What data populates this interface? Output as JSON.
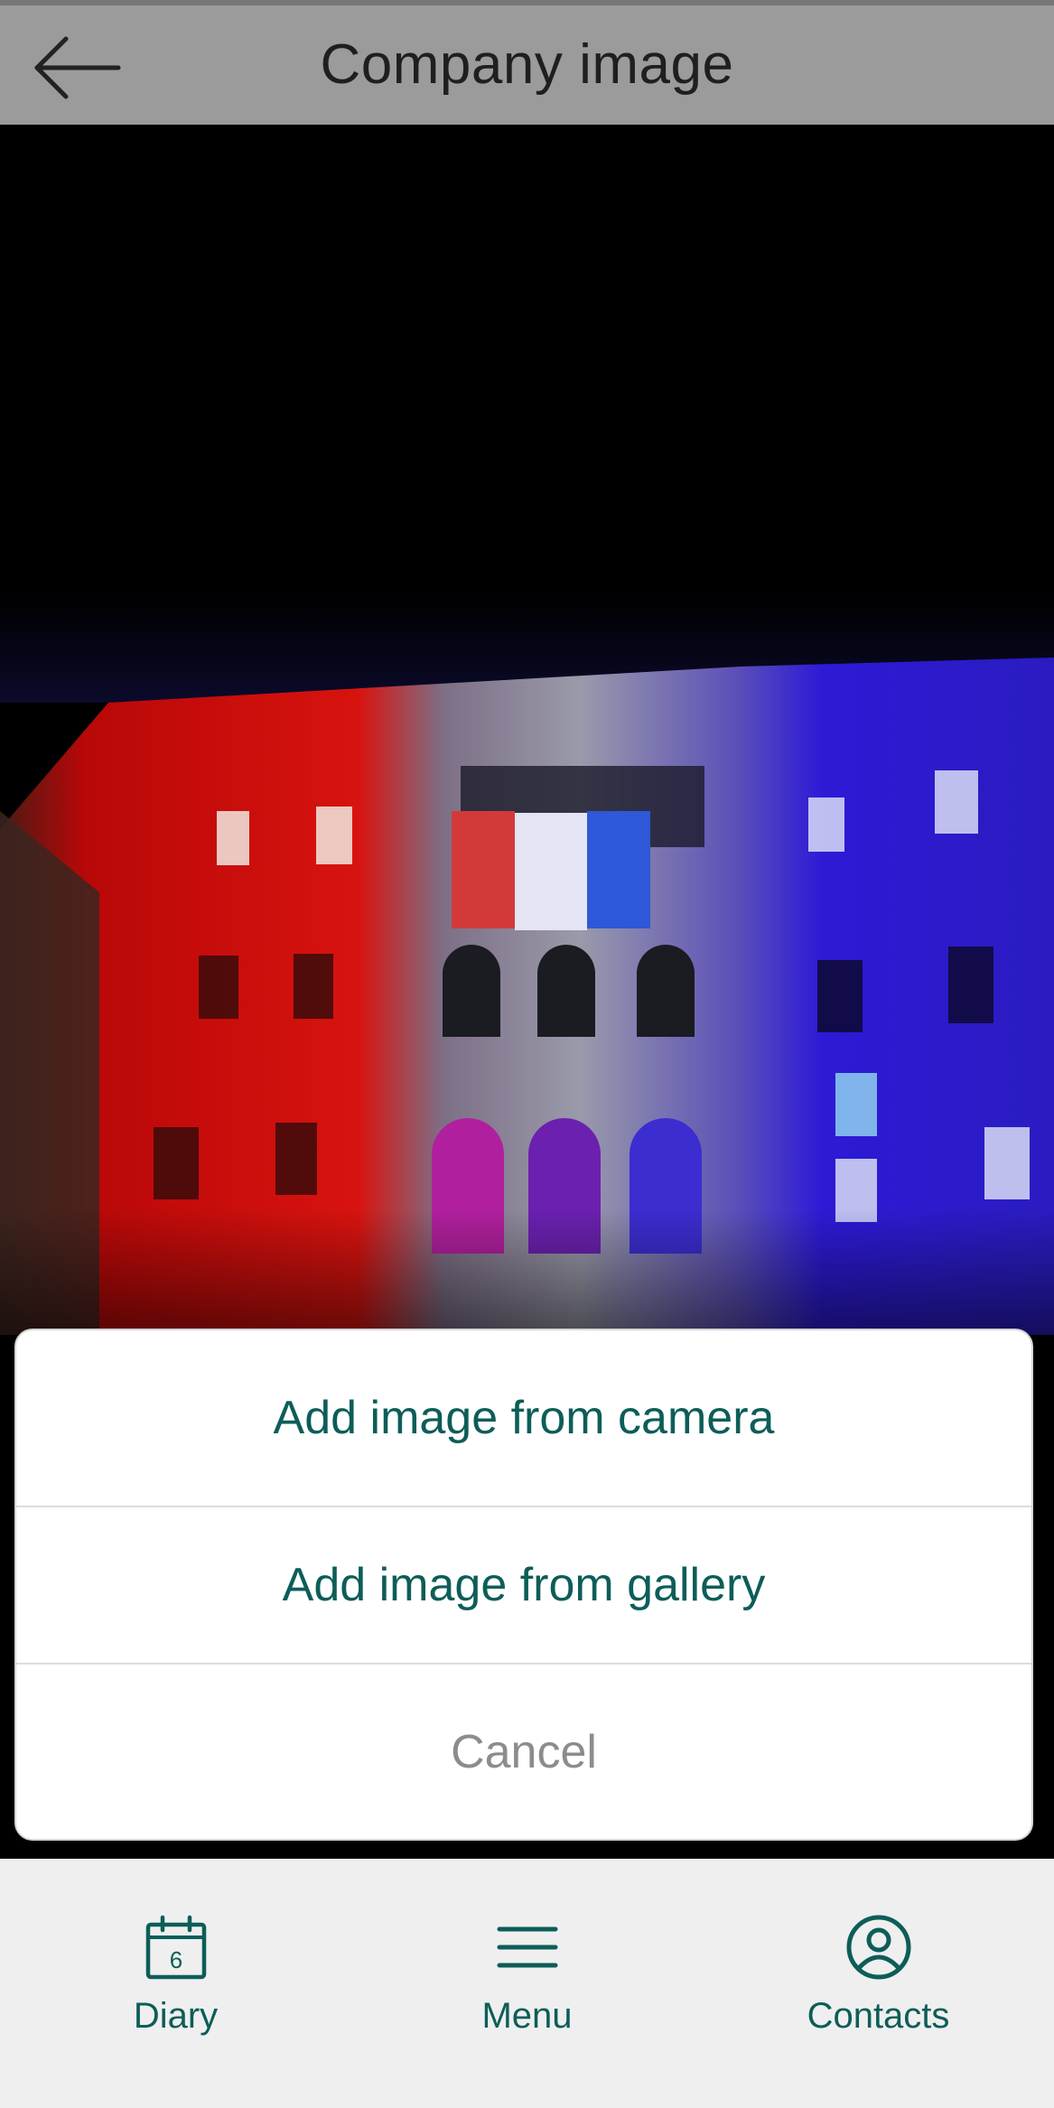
{
  "header": {
    "title": "Company image",
    "back_icon": "arrow-left-icon"
  },
  "photo": {
    "description_colors": {
      "red": "#d00c0c",
      "white": "#c9c9d6",
      "blue": "#2c1bd8"
    }
  },
  "sheet": {
    "items": [
      {
        "label": "Add image from camera"
      },
      {
        "label": "Add image from gallery"
      },
      {
        "label": "Cancel"
      }
    ],
    "accent": "#0d5d58",
    "cancel_color": "#8c8c8c"
  },
  "nav": {
    "items": [
      {
        "label": "Diary",
        "icon": "calendar-icon",
        "icon_text": "6"
      },
      {
        "label": "Menu",
        "icon": "hamburger-menu-icon"
      },
      {
        "label": "Contacts",
        "icon": "user-circle-icon"
      }
    ]
  }
}
